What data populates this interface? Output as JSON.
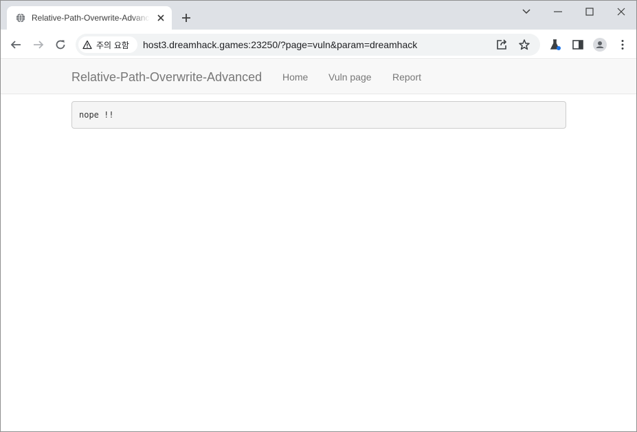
{
  "browser": {
    "tab": {
      "title": "Relative-Path-Overwrite-Advanced",
      "favicon": "globe-icon"
    },
    "window_controls": [
      "tab-search-icon",
      "minimize-icon",
      "maximize-icon",
      "close-icon"
    ],
    "toolbar": {
      "security_label": "주의 요함",
      "url": "host3.dreamhack.games:23250/?page=vuln&param=dreamhack"
    }
  },
  "site": {
    "brand": "Relative-Path-Overwrite-Advanced",
    "nav": [
      {
        "label": "Home"
      },
      {
        "label": "Vuln page"
      },
      {
        "label": "Report"
      }
    ],
    "output": "nope !!"
  },
  "colors": {
    "tabstrip_bg": "#dee1e6",
    "omnibox_bg": "#f1f3f4",
    "navbar_bg": "#f8f8f8",
    "nav_text": "#777777",
    "pre_bg": "#f5f5f5",
    "accent_blue": "#1a73e8"
  }
}
